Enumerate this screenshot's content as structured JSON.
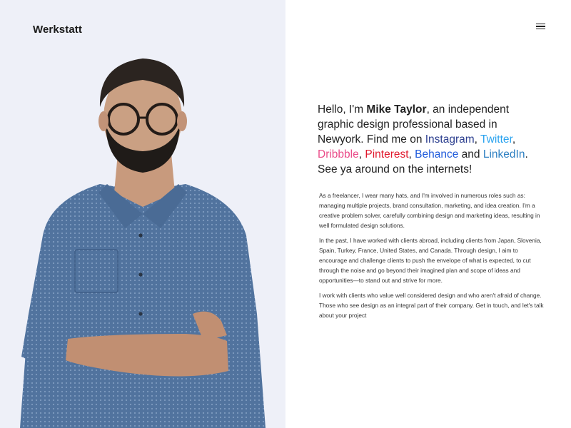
{
  "brand": {
    "name": "Werkstatt"
  },
  "menu": {
    "icon": "hamburger-menu-icon"
  },
  "intro": {
    "greeting": "Hello, I'm ",
    "name": "Mike Taylor",
    "text_1": ", an independent graphic design professional based in Newyork. Find me on ",
    "links": {
      "instagram": "Instagram",
      "twitter": "Twitter",
      "dribbble": "Dribbble",
      "pinterest": "Pinterest",
      "behance": "Behance",
      "linkedin": "LinkedIn"
    },
    "sep_1": ", ",
    "sep_2": ", ",
    "sep_3": ", ",
    "sep_4": ",",
    "sep_5": " and ",
    "text_2": ". See ya around on the internets!"
  },
  "bio": {
    "paragraphs": [
      "As a freelancer, I wear many hats, and I'm involved in numerous roles such as: managing multiple projects, brand consultation, marketing, and idea creation. I'm a creative problem solver, carefully combining design and marketing ideas, resulting in well formulated design solutions.",
      "In the past, I have worked with clients abroad, including clients from Japan, Slovenia, Spain, Turkey, France, United States, and Canada. Through design, I aim to encourage and challenge clients to push the envelope of what is expected, to cut through the noise and go beyond their imagined plan and scope of ideas and opportunities—to stand out and strive for more.",
      "I work with clients who value well considered design and who aren't afraid of change. Those who see design as an integral part of their company. Get in touch, and let's talk about your project"
    ]
  },
  "colors": {
    "left_background": "#eef0f8",
    "instagram": "#2c3f8f",
    "twitter": "#2aa3ef",
    "dribbble": "#ea4c89",
    "pinterest": "#e0182d",
    "behance": "#1e5adb",
    "linkedin": "#2d7fc2"
  }
}
